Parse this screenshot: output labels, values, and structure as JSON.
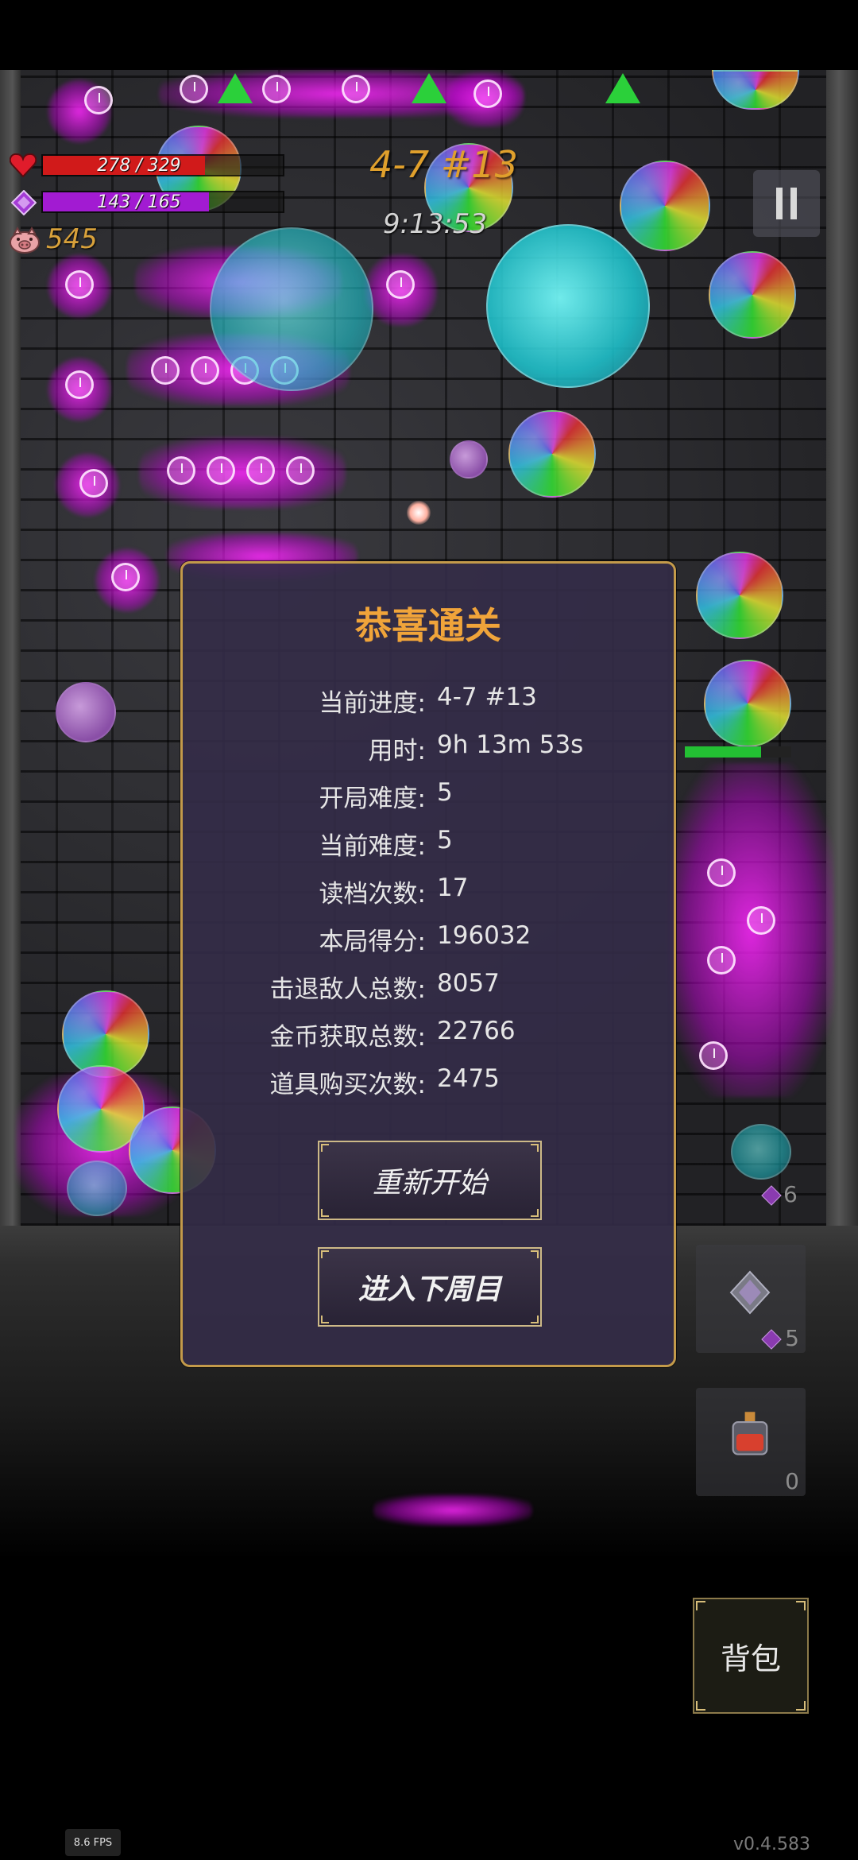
{
  "hud": {
    "hp_text": "278 / 329",
    "hp_fraction": 0.845,
    "mp_text": "143 / 165",
    "mp_fraction": 0.867,
    "gold": "545",
    "stage": "4-7 #13",
    "timer": "9:13:53"
  },
  "dialog": {
    "title": "恭喜通关",
    "stats": [
      {
        "label": "当前进度:",
        "value": "4-7 #13"
      },
      {
        "label": "用时:",
        "value": "9h 13m 53s"
      },
      {
        "label": "开局难度:",
        "value": "5"
      },
      {
        "label": "当前难度:",
        "value": "5"
      },
      {
        "label": "读档次数:",
        "value": "17"
      },
      {
        "label": "本局得分:",
        "value": "196032"
      },
      {
        "label": "击退敌人总数:",
        "value": "8057"
      },
      {
        "label": "金币获取总数:",
        "value": "22766"
      },
      {
        "label": "道具购买次数:",
        "value": "2475"
      }
    ],
    "restart_label": "重新开始",
    "next_cycle_label": "进入下周目"
  },
  "slots": {
    "top_count": "6",
    "slot1_count": "5",
    "slot2_count": "0"
  },
  "bag_label": "背包",
  "fps": "8.6 FPS",
  "version": "v0.4.583",
  "colors": {
    "hp": "#d11a1a",
    "mp": "#a21bd2",
    "gold": "#d8a13b",
    "stage": "#e0a02c",
    "dialog_border": "#c39a4a",
    "dialog_title": "#f0a43a"
  }
}
